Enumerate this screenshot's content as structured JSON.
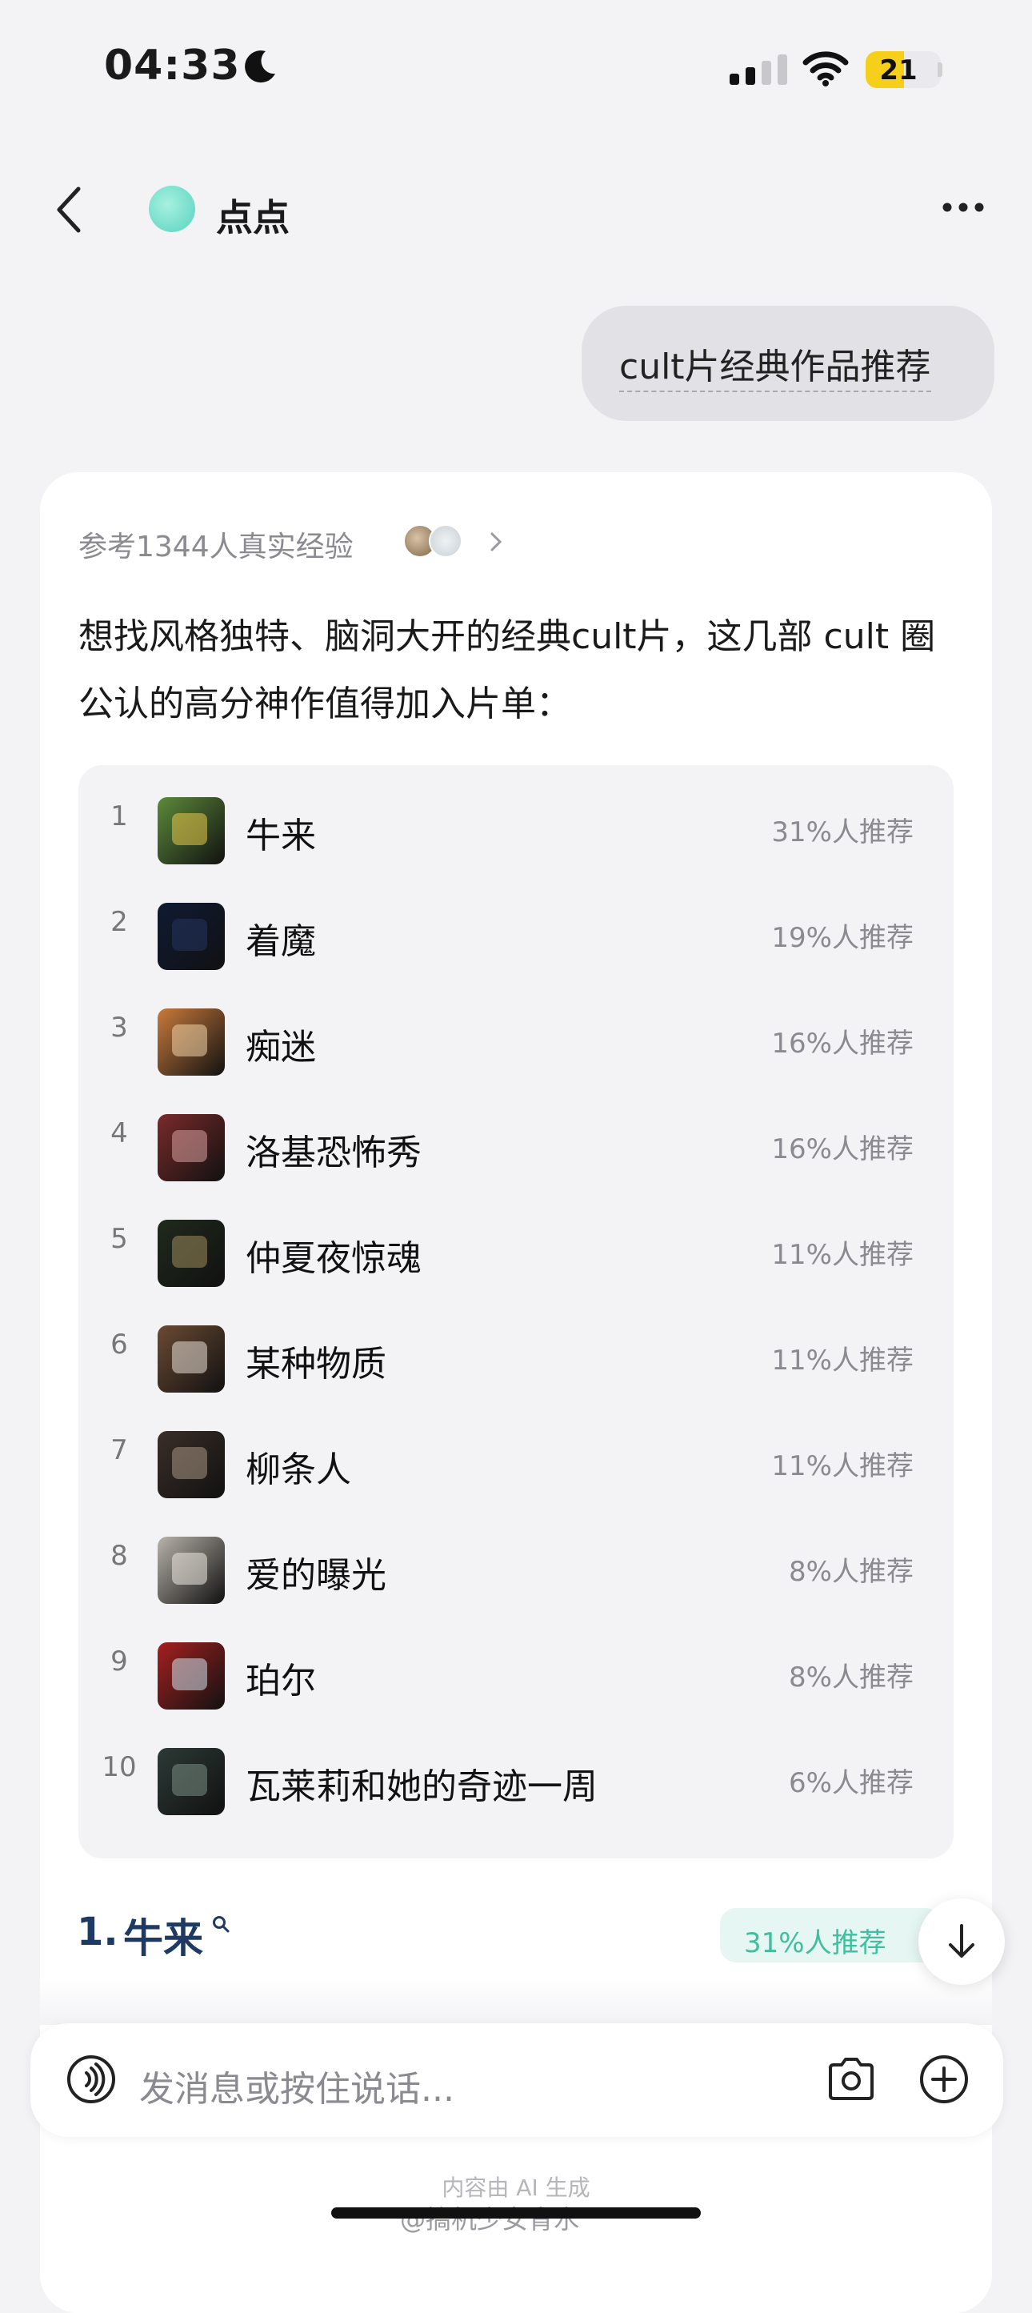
{
  "status_bar": {
    "time": "04:33",
    "battery": "21"
  },
  "header": {
    "bot_name": "点点"
  },
  "user_message": "cult片经典作品推荐",
  "answer": {
    "reference": "参考1344人真实经验",
    "intro": "想找风格独特、脑洞大开的经典cult片，这几部 cult 圈公认的高分神作值得加入片单：",
    "items": [
      {
        "rank": "1",
        "title": "牛来",
        "percent": "31%人推荐",
        "thumb_color": "#5c8a3a",
        "thumb_hl": "#e8c84a"
      },
      {
        "rank": "2",
        "title": "着魔",
        "percent": "19%人推荐",
        "thumb_color": "#0f1a33",
        "thumb_hl": "#22355e"
      },
      {
        "rank": "3",
        "title": "痴迷",
        "percent": "16%人推荐",
        "thumb_color": "#c97a3c",
        "thumb_hl": "#f0d3a8"
      },
      {
        "rank": "4",
        "title": "洛基恐怖秀",
        "percent": "16%人推荐",
        "thumb_color": "#7a2a2a",
        "thumb_hl": "#d9a0a0"
      },
      {
        "rank": "5",
        "title": "仲夏夜惊魂",
        "percent": "11%人推荐",
        "thumb_color": "#1f2a1c",
        "thumb_hl": "#9e8a5c"
      },
      {
        "rank": "6",
        "title": "某种物质",
        "percent": "11%人推荐",
        "thumb_color": "#6b4a33",
        "thumb_hl": "#e8e0d6"
      },
      {
        "rank": "7",
        "title": "柳条人",
        "percent": "11%人推荐",
        "thumb_color": "#3a2e28",
        "thumb_hl": "#a89584"
      },
      {
        "rank": "8",
        "title": "爱的曝光",
        "percent": "8%人推荐",
        "thumb_color": "#b8b2aa",
        "thumb_hl": "#ece7e0"
      },
      {
        "rank": "9",
        "title": "珀尔",
        "percent": "8%人推荐",
        "thumb_color": "#a52020",
        "thumb_hl": "#cfe3ee"
      },
      {
        "rank": "10",
        "title": "瓦莱莉和她的奇迹一周",
        "percent": "6%人推荐",
        "thumb_color": "#2c3a36",
        "thumb_hl": "#7a8c84"
      }
    ],
    "section": {
      "number": "1.",
      "title": "牛来",
      "badge": "31%人推荐"
    }
  },
  "input": {
    "placeholder": "发消息或按住说话..."
  },
  "footer": {
    "ai_note": "内容由 AI 生成",
    "watermark": "@搞机少女青水"
  }
}
